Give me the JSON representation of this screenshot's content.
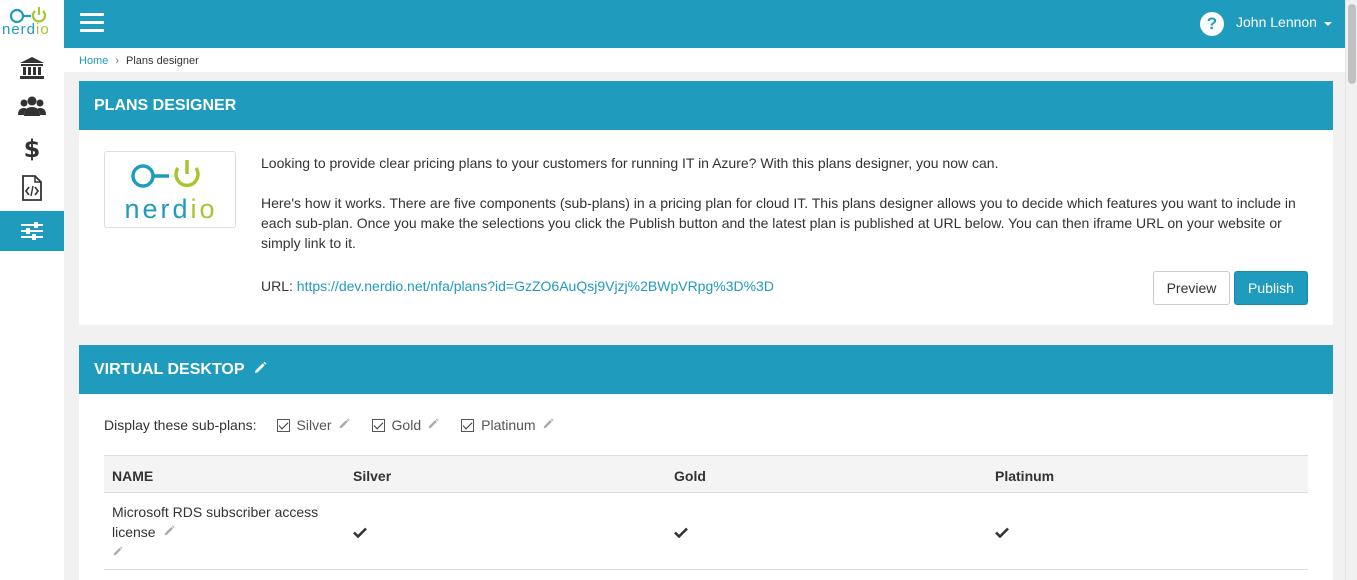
{
  "brand": {
    "name": "nerdio",
    "accent": "#1f9bbd",
    "logo_green": "#a6c631"
  },
  "sidebar": {
    "items": [
      {
        "icon": "bank-icon"
      },
      {
        "icon": "users-icon"
      },
      {
        "icon": "dollar-icon"
      },
      {
        "icon": "code-file-icon"
      },
      {
        "icon": "sliders-icon",
        "active": true
      }
    ]
  },
  "header": {
    "user_name": "John Lennon"
  },
  "breadcrumb": {
    "home": "Home",
    "current": "Plans designer"
  },
  "designer": {
    "title": "PLANS DESIGNER",
    "intro_p1": "Looking to provide clear pricing plans to your customers for running IT in Azure? With this plans designer, you now can.",
    "intro_p2": "Here's how it works. There are five components (sub-plans) in a pricing plan for cloud IT. This plans designer allows you to decide which features you want to include in each sub-plan. Once you make the selections you click the Publish button and the latest plan is published at URL below. You can then iframe URL on your website or simply link to it.",
    "url_label": "URL:",
    "url": "https://dev.nerdio.net/nfa/plans?id=GzZO6AuQsj9Vjzj%2BWpVRpg%3D%3D",
    "preview_label": "Preview",
    "publish_label": "Publish"
  },
  "virtual_desktop": {
    "title": "VIRTUAL DESKTOP",
    "subplans_label": "Display these sub-plans:",
    "subplans": [
      {
        "label": "Silver",
        "checked": true
      },
      {
        "label": "Gold",
        "checked": true
      },
      {
        "label": "Platinum",
        "checked": true
      }
    ],
    "columns": [
      "NAME",
      "Silver",
      "Gold",
      "Platinum"
    ],
    "rows": [
      {
        "name": "Microsoft RDS subscriber access license",
        "silver": true,
        "gold": true,
        "platinum": true
      }
    ]
  }
}
